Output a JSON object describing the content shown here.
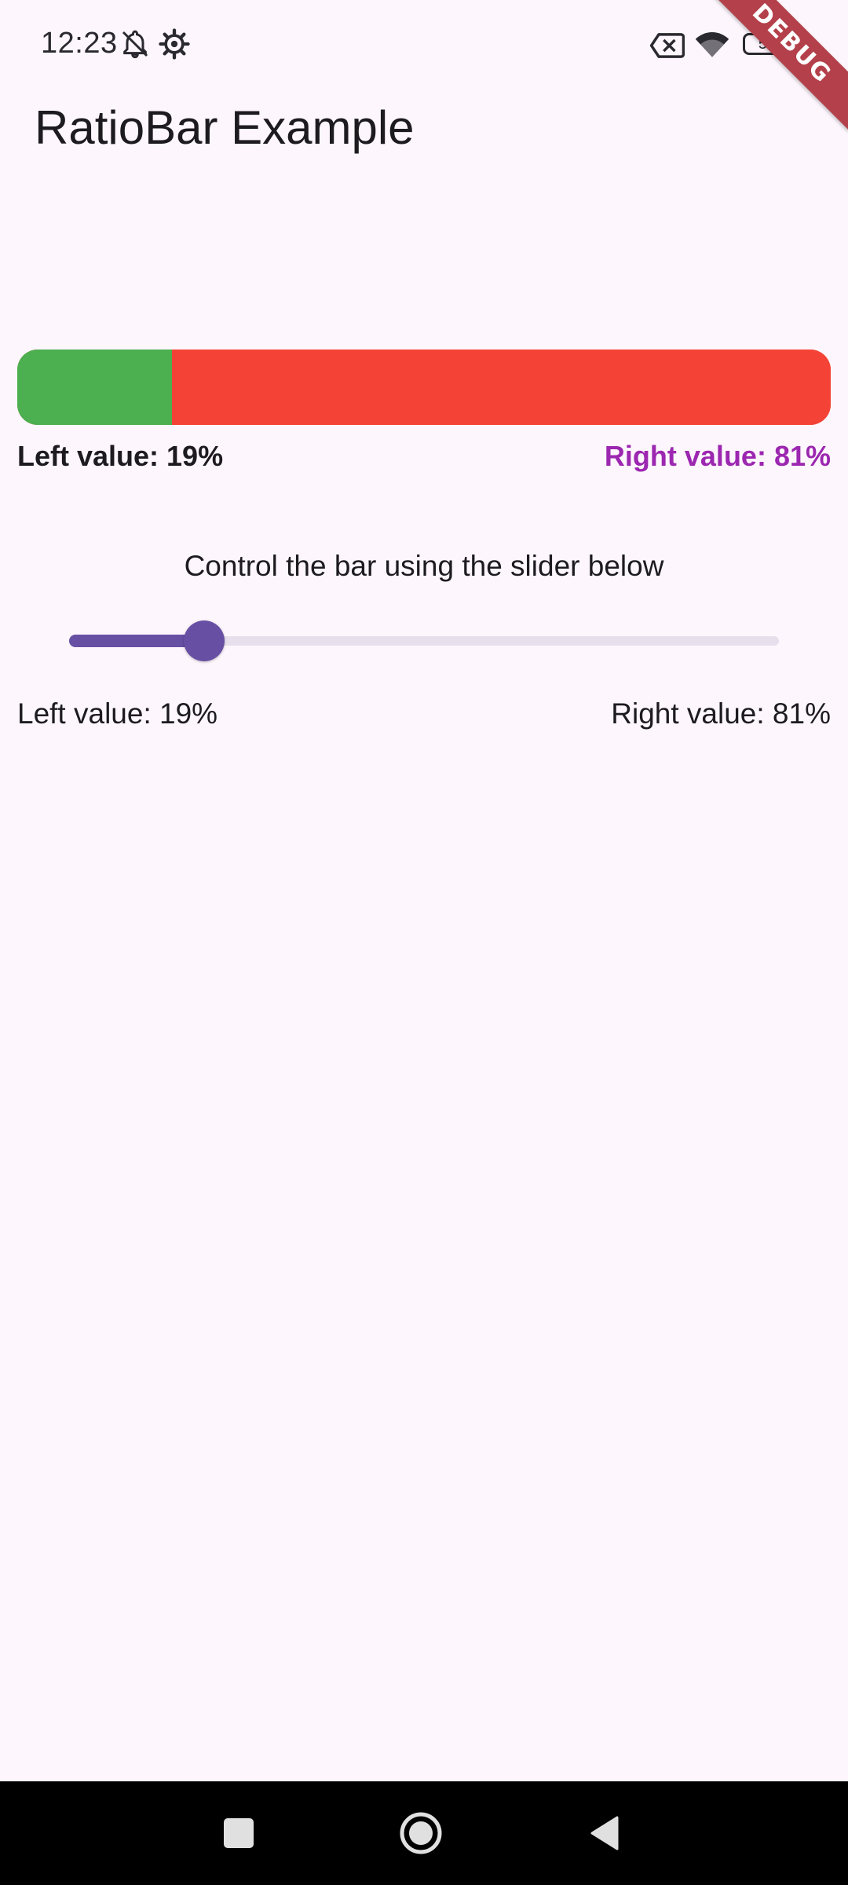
{
  "status_bar": {
    "time": "12:23",
    "battery_level": "54",
    "icons": [
      "bell-off-icon",
      "settings-icon",
      "no-sim-icon",
      "wifi-icon",
      "battery-icon"
    ]
  },
  "debug_banner": "DEBUG",
  "app_bar": {
    "title": "RatioBar Example"
  },
  "ratio_bar": {
    "left_fraction": 0.19,
    "left_color": "#4caf50",
    "right_color": "#f44336",
    "left_label": "Left value: 19%",
    "right_label": "Right value: 81%",
    "right_label_color": "#9c27b0"
  },
  "slider_section": {
    "caption": "Control the bar using the slider below",
    "value": 0.19,
    "accent_color": "#6750a4",
    "left_label": "Left value: 19%",
    "right_label": "Right value: 81%"
  },
  "nav_bar": {
    "buttons": [
      "recents-icon",
      "home-icon",
      "back-icon"
    ]
  }
}
